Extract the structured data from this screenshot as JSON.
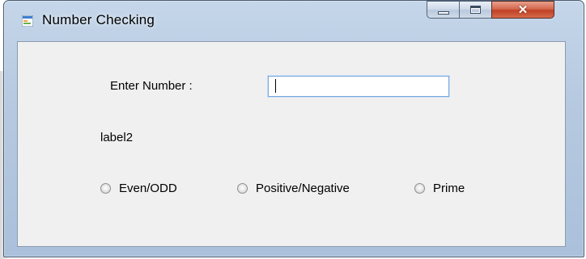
{
  "window": {
    "title": "Number Checking",
    "controls": {
      "close": "✕"
    }
  },
  "form": {
    "prompt_label": "Enter Number :",
    "number_input": {
      "value": ""
    },
    "result_label": "label2",
    "radios": [
      {
        "label": "Even/ODD",
        "checked": false
      },
      {
        "label": "Positive/Negative",
        "checked": false
      },
      {
        "label": "Prime",
        "checked": false
      }
    ]
  },
  "colors": {
    "close_button": "#c24125",
    "focus_border": "#7aa7dd",
    "client_bg": "#f0f0f0"
  }
}
